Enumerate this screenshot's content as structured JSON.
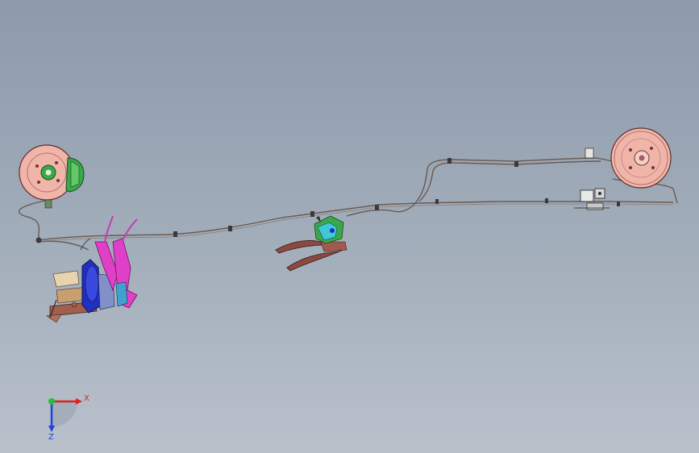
{
  "viewport": {
    "background_top": "#8d9aab",
    "background_bottom": "#b9c1cb"
  },
  "model": {
    "parts": [
      "front-brake-disc",
      "front-brake-caliper",
      "brake-pedal-assembly",
      "handbrake-lever-assembly",
      "brake-line",
      "rear-brake-drum",
      "rear-brake-valve"
    ],
    "colors": {
      "disc": "#f0b4a8",
      "caliper": "#3aa84a",
      "pedal_magenta": "#e040c8",
      "pedal_blue": "#2030c0",
      "bracket_brown": "#a0604c",
      "lever_brown": "#8a4a40",
      "line": "#6a5a52",
      "handle_cyan": "#40c8d8"
    }
  },
  "triad": {
    "x_label": "X",
    "z_label": "Z",
    "x_color": "#e02020",
    "z_color": "#2040e0",
    "origin_color": "#20c040"
  }
}
